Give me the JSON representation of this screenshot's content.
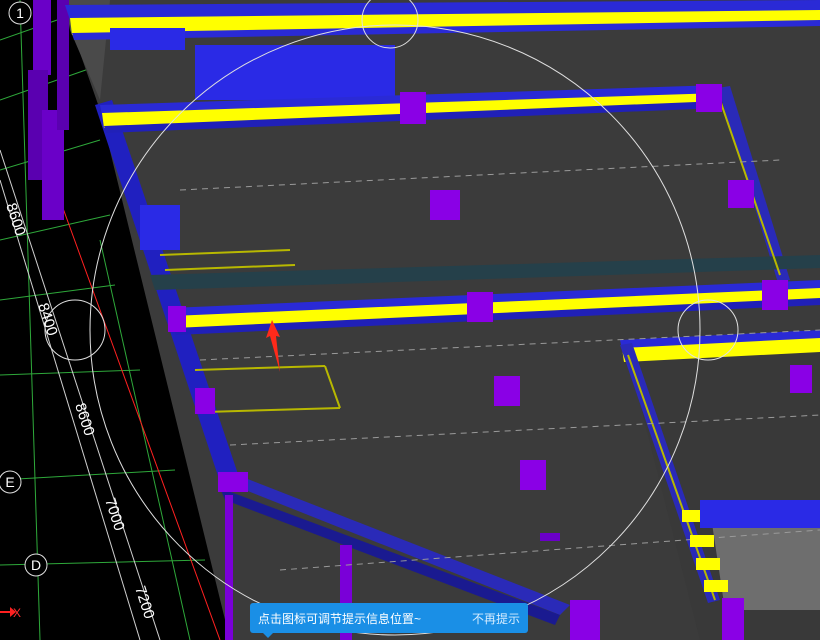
{
  "axis_grid": {
    "bubbles": [
      {
        "label": "1"
      },
      {
        "label": "E"
      },
      {
        "label": "D"
      }
    ],
    "dimensions": [
      {
        "text": "8600"
      },
      {
        "text": "8400"
      },
      {
        "text": "8600"
      },
      {
        "text": "7000"
      },
      {
        "text": "7200"
      }
    ],
    "x_axis_label": "X"
  },
  "tip": {
    "message": "点击图标可调节提示信息位置~",
    "dismiss_label": "不再提示"
  },
  "colors": {
    "background": "#000000",
    "slab": "#3c3c3c",
    "beam_blue": "#2323d6",
    "beam_yellow": "#ffff00",
    "column_purple": "#8a00e6",
    "grid_green": "#2ea83a",
    "tip_blue": "#1a8fe6",
    "axis_red": "#ff2020"
  },
  "icons": {
    "orientation_arrow": "north-arrow-icon",
    "x_axis": "axis-triad-icon"
  }
}
